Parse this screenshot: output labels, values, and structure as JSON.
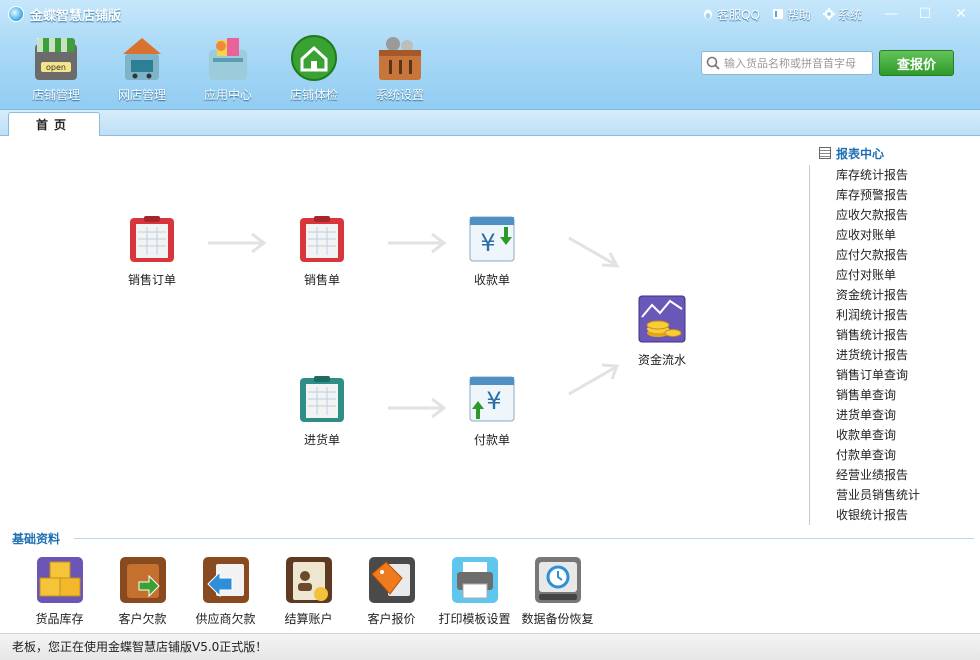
{
  "app": {
    "title": "金蝶智慧店铺版"
  },
  "top_links": {
    "qq": "客服QQ",
    "help": "帮助",
    "system": "系统"
  },
  "window": {
    "minimize": "—",
    "maximize": "☐",
    "close": "✕"
  },
  "toolbar": [
    {
      "label": "店铺管理",
      "icon": "store-icon"
    },
    {
      "label": "网店管理",
      "icon": "online-shop-icon"
    },
    {
      "label": "应用中心",
      "icon": "app-center-icon"
    },
    {
      "label": "店铺体检",
      "icon": "home-check-icon"
    },
    {
      "label": "系统设置",
      "icon": "settings-toolbox-icon"
    }
  ],
  "search": {
    "placeholder": "输入货品名称或拼音首字母",
    "button": "查报价"
  },
  "tabs": [
    {
      "label": "首页"
    }
  ],
  "flow": {
    "sales_order": "销售订单",
    "sales_slip": "销售单",
    "receipt": "收款单",
    "cash_flow": "资金流水",
    "purchase_slip": "进货单",
    "payment": "付款单"
  },
  "reports": {
    "title": "报表中心",
    "items": [
      "库存统计报告",
      "库存预警报告",
      "应收欠款报告",
      "应收对账单",
      "应付欠款报告",
      "应付对账单",
      "资金统计报告",
      "利润统计报告",
      "销售统计报告",
      "进货统计报告",
      "销售订单查询",
      "销售单查询",
      "进货单查询",
      "收款单查询",
      "付款单查询",
      "经营业绩报告",
      "营业员销售统计",
      "收银统计报告"
    ]
  },
  "basic": {
    "title": "基础资料",
    "items": [
      {
        "label": "货品库存",
        "icon": "inventory-boxes-icon"
      },
      {
        "label": "客户欠款",
        "icon": "customer-debt-icon"
      },
      {
        "label": "供应商欠款",
        "icon": "supplier-debt-icon"
      },
      {
        "label": "结算账户",
        "icon": "account-book-icon"
      },
      {
        "label": "客户报价",
        "icon": "price-tag-icon"
      },
      {
        "label": "打印模板设置",
        "icon": "printer-icon"
      },
      {
        "label": "数据备份恢复",
        "icon": "backup-restore-icon"
      }
    ]
  },
  "status": {
    "text": "老板，您正在使用金蝶智慧店铺版V5.0正式版！"
  },
  "colors": {
    "accent": "#1f6fb3",
    "header": "#aad9f6",
    "button_green": "#2f9a2b"
  }
}
